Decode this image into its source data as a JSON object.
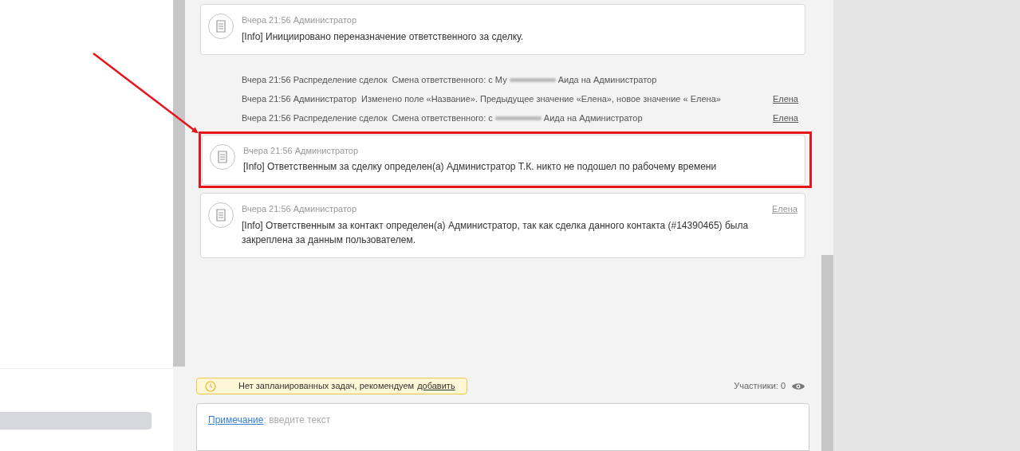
{
  "events": [
    {
      "kind": "note",
      "meta": "Вчера 21:56 Администратор",
      "text": "[Info] Инициировано переназначение ответственного за сделку.",
      "highlighted": false
    },
    {
      "kind": "history",
      "meta": "Вчера 21:56 Распределение сделок",
      "parts": [
        "Смена ответственного: с Му",
        "Аида на Администратор"
      ]
    },
    {
      "kind": "history",
      "meta": "Вчера 21:56 Администратор",
      "parts": [
        "Изменено поле «Название». Предыдущее значение «Елена», новое значение « Елена»"
      ],
      "author": "Елена"
    },
    {
      "kind": "history",
      "meta": "Вчера 21:56 Распределение сделок",
      "parts": [
        "Смена ответственного: с",
        "Аида на Администратор"
      ],
      "author": "Елена"
    },
    {
      "kind": "note",
      "meta": "Вчера 21:56 Администратор",
      "text": "[Info] Ответственным за сделку определен(а) Администратор Т.К. никто не подошел по рабочему времени",
      "highlighted": true
    },
    {
      "kind": "note",
      "meta": "Вчера 21:56 Администратор",
      "text": "[Info] Ответственным за контакт определен(а) Администратор, так как сделка данного контакта (#14390465) была закреплена за данным пользователем.",
      "author": "Елена",
      "highlighted": false
    }
  ],
  "tasks_notice": {
    "text": "Нет запланированных задач, рекомендуем",
    "link": "добавить"
  },
  "participants": "Участники: 0",
  "composer": {
    "type_link": "Примечание",
    "placeholder": ": введите текст"
  }
}
